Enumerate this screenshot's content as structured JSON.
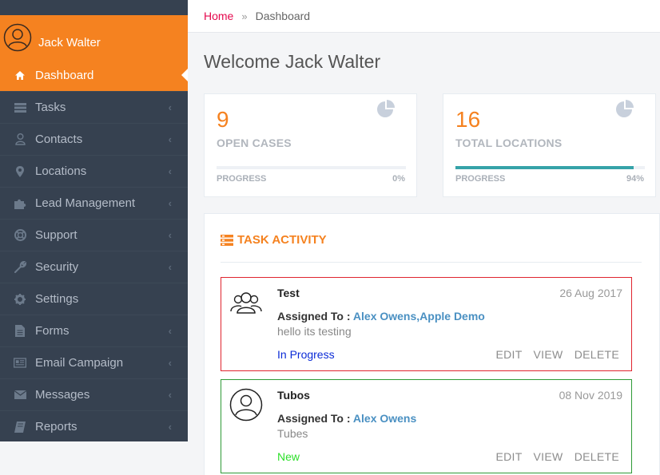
{
  "user": {
    "name": "Jack Walter"
  },
  "sidebar": {
    "items": [
      {
        "label": "Dashboard",
        "icon": "home-icon",
        "active": true,
        "has_children": false
      },
      {
        "label": "Tasks",
        "icon": "list-icon",
        "active": false,
        "has_children": true
      },
      {
        "label": "Contacts",
        "icon": "user-icon",
        "active": false,
        "has_children": true
      },
      {
        "label": "Locations",
        "icon": "map-pin-icon",
        "active": false,
        "has_children": true
      },
      {
        "label": "Lead Management",
        "icon": "puzzle-icon",
        "active": false,
        "has_children": true
      },
      {
        "label": "Support",
        "icon": "lifebuoy-icon",
        "active": false,
        "has_children": true
      },
      {
        "label": "Security",
        "icon": "wrench-icon",
        "active": false,
        "has_children": true
      },
      {
        "label": "Settings",
        "icon": "gear-icon",
        "active": false,
        "has_children": false
      },
      {
        "label": "Forms",
        "icon": "file-icon",
        "active": false,
        "has_children": true
      },
      {
        "label": "Email Campaign",
        "icon": "newspaper-icon",
        "active": false,
        "has_children": true
      },
      {
        "label": "Messages",
        "icon": "envelope-icon",
        "active": false,
        "has_children": true
      },
      {
        "label": "Reports",
        "icon": "book-icon",
        "active": false,
        "has_children": true
      }
    ],
    "chevron": "‹"
  },
  "breadcrumb": {
    "home": "Home",
    "separator": "»",
    "current": "Dashboard"
  },
  "page_title": "Welcome Jack Walter",
  "stats": [
    {
      "value": "9",
      "label": "OPEN CASES",
      "progress_label": "PROGRESS",
      "progress_text": "0%",
      "progress": 0
    },
    {
      "value": "16",
      "label": "TOTAL LOCATIONS",
      "progress_label": "PROGRESS",
      "progress_text": "94%",
      "progress": 94
    }
  ],
  "activity": {
    "title": "TASK ACTIVITY",
    "tasks": [
      {
        "title": "Test",
        "date": "26 Aug 2017",
        "assigned_label": "Assigned To :",
        "assignees": "Alex Owens,Apple Demo",
        "description": "hello its testing",
        "status": "In Progress",
        "status_color": "#0b2bd6",
        "border_color": "#e0242e",
        "avatar": "group-icon"
      },
      {
        "title": "Tubos",
        "date": "08 Nov 2019",
        "assigned_label": "Assigned To :",
        "assignees": "Alex Owens",
        "description": "Tubes",
        "status": "New",
        "status_color": "#2ee02b",
        "border_color": "#2e9a36",
        "avatar": "user-circle-icon"
      }
    ],
    "actions": {
      "edit": "EDIT",
      "view": "VIEW",
      "delete": "DELETE"
    }
  },
  "colors": {
    "accent": "#f58220",
    "sidebar_bg": "#364150",
    "progress": "#36a3a9"
  }
}
